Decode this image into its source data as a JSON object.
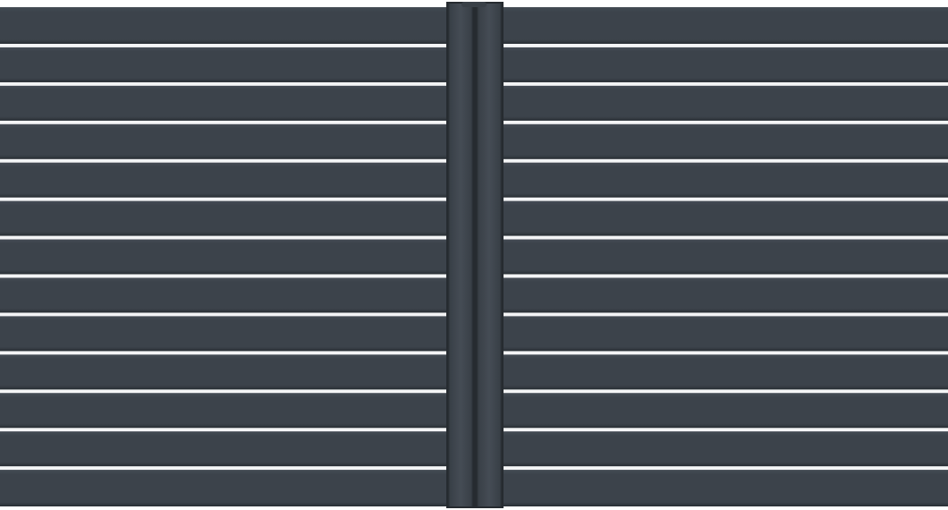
{
  "scene": {
    "subject": "gate-panel",
    "leaves": 2,
    "slats_per_leaf": 13,
    "colors": {
      "slat": "#3c434b",
      "slat_highlight": "#454c55",
      "slat_shadow": "#2c3238",
      "gap": "#f4f5f6",
      "post": "#394047",
      "post_edge": "#262b30",
      "background": "#ffffff"
    }
  }
}
